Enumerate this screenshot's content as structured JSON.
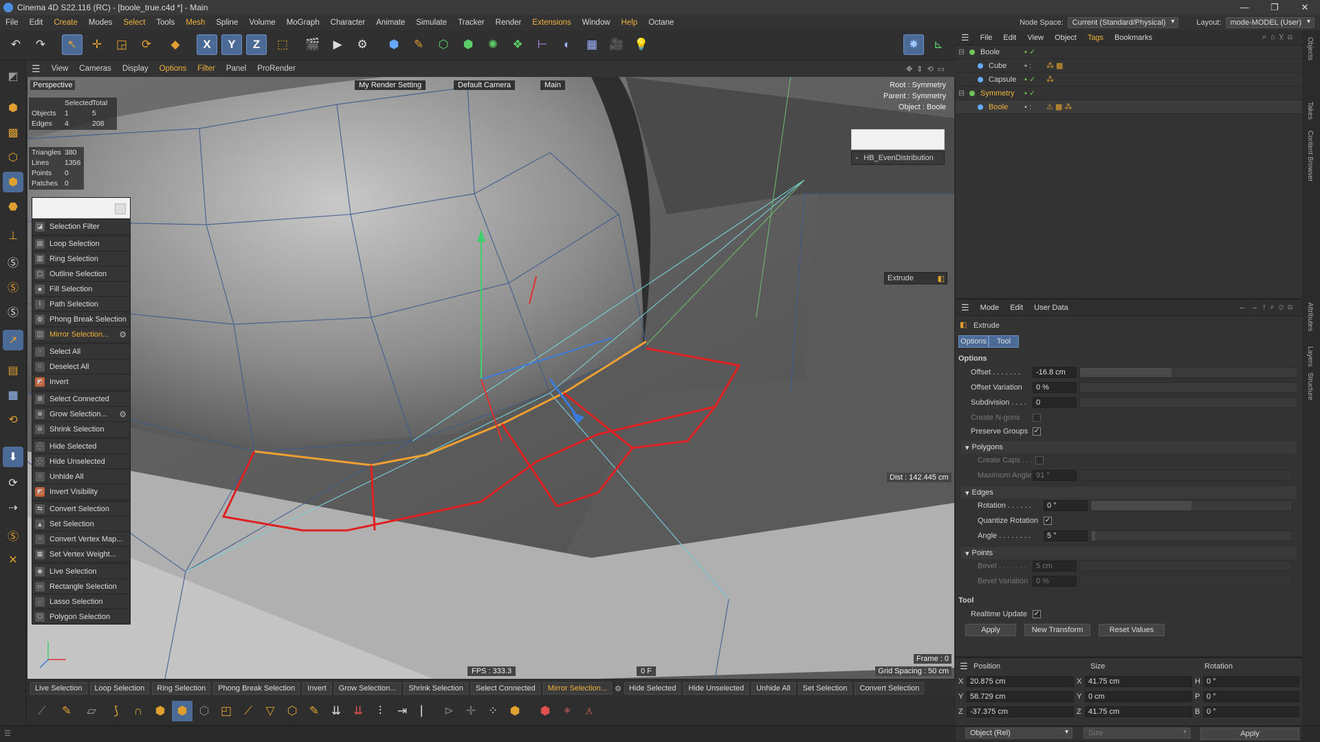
{
  "window": {
    "title": "Cinema 4D S22.116 (RC) - [boole_true.c4d *] - Main",
    "controls": [
      "—",
      "❐",
      "✕"
    ]
  },
  "menubar": {
    "items": [
      "File",
      "Edit",
      "Create",
      "Modes",
      "Select",
      "Tools",
      "Mesh",
      "Spline",
      "Volume",
      "MoGraph",
      "Character",
      "Animate",
      "Simulate",
      "Tracker",
      "Render",
      "Extensions",
      "Window",
      "Help",
      "Octane"
    ],
    "node_space_label": "Node Space:",
    "node_space_value": "Current (Standard/Physical)",
    "layout_label": "Layout:",
    "layout_value": "mode-MODEL (User)"
  },
  "toolbar": {
    "axis_x": "X",
    "axis_y": "Y",
    "axis_z": "Z"
  },
  "viewport_menu": {
    "items": [
      "View",
      "Cameras",
      "Display",
      "Options",
      "Filter",
      "Panel",
      "ProRender"
    ]
  },
  "viewport": {
    "view_name": "Perspective",
    "render_setting": "My Render Setting",
    "camera": "Default Camera",
    "main": "Main",
    "root": "Root : Symmetry",
    "parent": "Parent : Symmetry",
    "object": "Object : Boole",
    "plugin_label": "HB_EvenDistribution",
    "extrude_label": "Extrude",
    "dist": "Dist : 142.445 cm",
    "fps": "FPS : 333.3",
    "frame_center": "0 F",
    "frame": "Frame : 0",
    "grid_spacing": "Grid Spacing : 50 cm",
    "stats": {
      "header_selected": "Selected",
      "header_total": "Total",
      "objects_label": "Objects",
      "objects_selected": "1",
      "objects_total": "5",
      "edges_label": "Edges",
      "edges_selected": "4",
      "edges_total": "208"
    },
    "counts": {
      "triangles_label": "Triangles",
      "triangles": "380",
      "lines_label": "Lines",
      "lines": "1356",
      "points_label": "Points",
      "points": "0",
      "patches_label": "Patches",
      "patches": "0"
    }
  },
  "select_menu": {
    "items": [
      {
        "label": "Selection Filter",
        "icon": "filter-icon"
      },
      {
        "label": "Loop Selection",
        "icon": "loop-icon"
      },
      {
        "label": "Ring Selection",
        "icon": "ring-icon"
      },
      {
        "label": "Outline Selection",
        "icon": "outline-icon"
      },
      {
        "label": "Fill Selection",
        "icon": "fill-icon"
      },
      {
        "label": "Path Selection",
        "icon": "path-icon"
      },
      {
        "label": "Phong Break Selection",
        "icon": "phong-icon"
      },
      {
        "label": "Mirror Selection...",
        "icon": "mirror-icon"
      },
      {
        "label": "Select All",
        "icon": "select-all-icon"
      },
      {
        "label": "Deselect All",
        "icon": "deselect-all-icon"
      },
      {
        "label": "Invert",
        "icon": "invert-icon"
      },
      {
        "label": "Select Connected",
        "icon": "connected-icon"
      },
      {
        "label": "Grow Selection...",
        "icon": "grow-icon"
      },
      {
        "label": "Shrink Selection",
        "icon": "shrink-icon"
      },
      {
        "label": "Hide Selected",
        "icon": "hide-selected-icon"
      },
      {
        "label": "Hide Unselected",
        "icon": "hide-unselected-icon"
      },
      {
        "label": "Unhide All",
        "icon": "unhide-icon"
      },
      {
        "label": "Invert Visibility",
        "icon": "invert-visibility-icon"
      },
      {
        "label": "Convert Selection",
        "icon": "convert-icon"
      },
      {
        "label": "Set Selection",
        "icon": "set-selection-icon"
      },
      {
        "label": "Convert Vertex Map...",
        "icon": "vertex-map-icon"
      },
      {
        "label": "Set Vertex Weight...",
        "icon": "vertex-weight-icon"
      },
      {
        "label": "Live Selection",
        "icon": "live-selection-icon"
      },
      {
        "label": "Rectangle Selection",
        "icon": "rectangle-selection-icon"
      },
      {
        "label": "Lasso Selection",
        "icon": "lasso-icon"
      },
      {
        "label": "Polygon Selection",
        "icon": "polygon-selection-icon"
      }
    ]
  },
  "bottom_commands": [
    "Live Selection",
    "Loop Selection",
    "Ring Selection",
    "Phong Break Selection",
    "Invert",
    "Grow Selection...",
    "Shrink Selection",
    "Select Connected",
    "Mirror Selection...",
    "Hide Selected",
    "Hide Unselected",
    "Unhide All",
    "Set Selection",
    "Convert Selection"
  ],
  "object_manager": {
    "menu": [
      "File",
      "Edit",
      "View",
      "Object",
      "Tags",
      "Bookmarks"
    ],
    "objects": [
      {
        "name": "Boole",
        "indent": 0
      },
      {
        "name": "Cube",
        "indent": 1
      },
      {
        "name": "Capsule",
        "indent": 1
      },
      {
        "name": "Symmetry",
        "indent": 0
      },
      {
        "name": "Boole",
        "indent": 1
      }
    ]
  },
  "attributes": {
    "menu": [
      "Mode",
      "Edit",
      "User Data"
    ],
    "tool_name": "Extrude",
    "tabs": [
      "Options",
      "Tool"
    ],
    "options_header": "Options",
    "offset_label": "Offset . . . . . . .",
    "offset": "-16.8 cm",
    "offset_variation_label": "Offset Variation",
    "offset_variation": "0 %",
    "subdivision_label": "Subdivision . . . .",
    "subdivision": "0",
    "create_ngons_label": "Create N-gons",
    "preserve_groups_label": "Preserve Groups",
    "polygons_header": "Polygons",
    "create_caps_label": "Create Caps . . .",
    "max_angle_label": "Maximum Angle",
    "max_angle": "91 °",
    "edges_header": "Edges",
    "rotation_label": "Rotation . . . . . .",
    "rotation": "0 °",
    "quantize_label": "Quantize Rotation",
    "angle_label": "Angle . . . . . . . .",
    "angle": "5 °",
    "points_header": "Points",
    "bevel_label": "Bevel . . . . . . .",
    "bevel": "5 cm",
    "bevel_variation_label": "Bevel Variation",
    "bevel_variation": "0 %",
    "tool_header": "Tool",
    "realtime_label": "Realtime Update",
    "apply": "Apply",
    "new_transform": "New Transform",
    "reset_values": "Reset Values",
    "offset_fraction": 0.42,
    "rotation_fraction": 0.5,
    "angle_fraction": 0.02
  },
  "coordinates": {
    "position_header": "Position",
    "size_header": "Size",
    "rotation_header": "Rotation",
    "px_label": "X",
    "px": "20.875 cm",
    "py_label": "Y",
    "py": "58.729 cm",
    "pz_label": "Z",
    "pz": "-37.375 cm",
    "sx_label": "X",
    "sx": "41.75 cm",
    "sy_label": "Y",
    "sy": "0 cm",
    "sz_label": "Z",
    "sz": "41.75 cm",
    "rh_label": "H",
    "rh": "0 °",
    "rp_label": "P",
    "rp": "0 °",
    "rb_label": "B",
    "rb": "0 °",
    "mode": "Object (Rel)",
    "size_mode": "Size",
    "apply": "Apply"
  },
  "right_tabs": [
    "Objects",
    "Takes",
    "Content Browser",
    "Attributes",
    "Layers",
    "Structure"
  ]
}
